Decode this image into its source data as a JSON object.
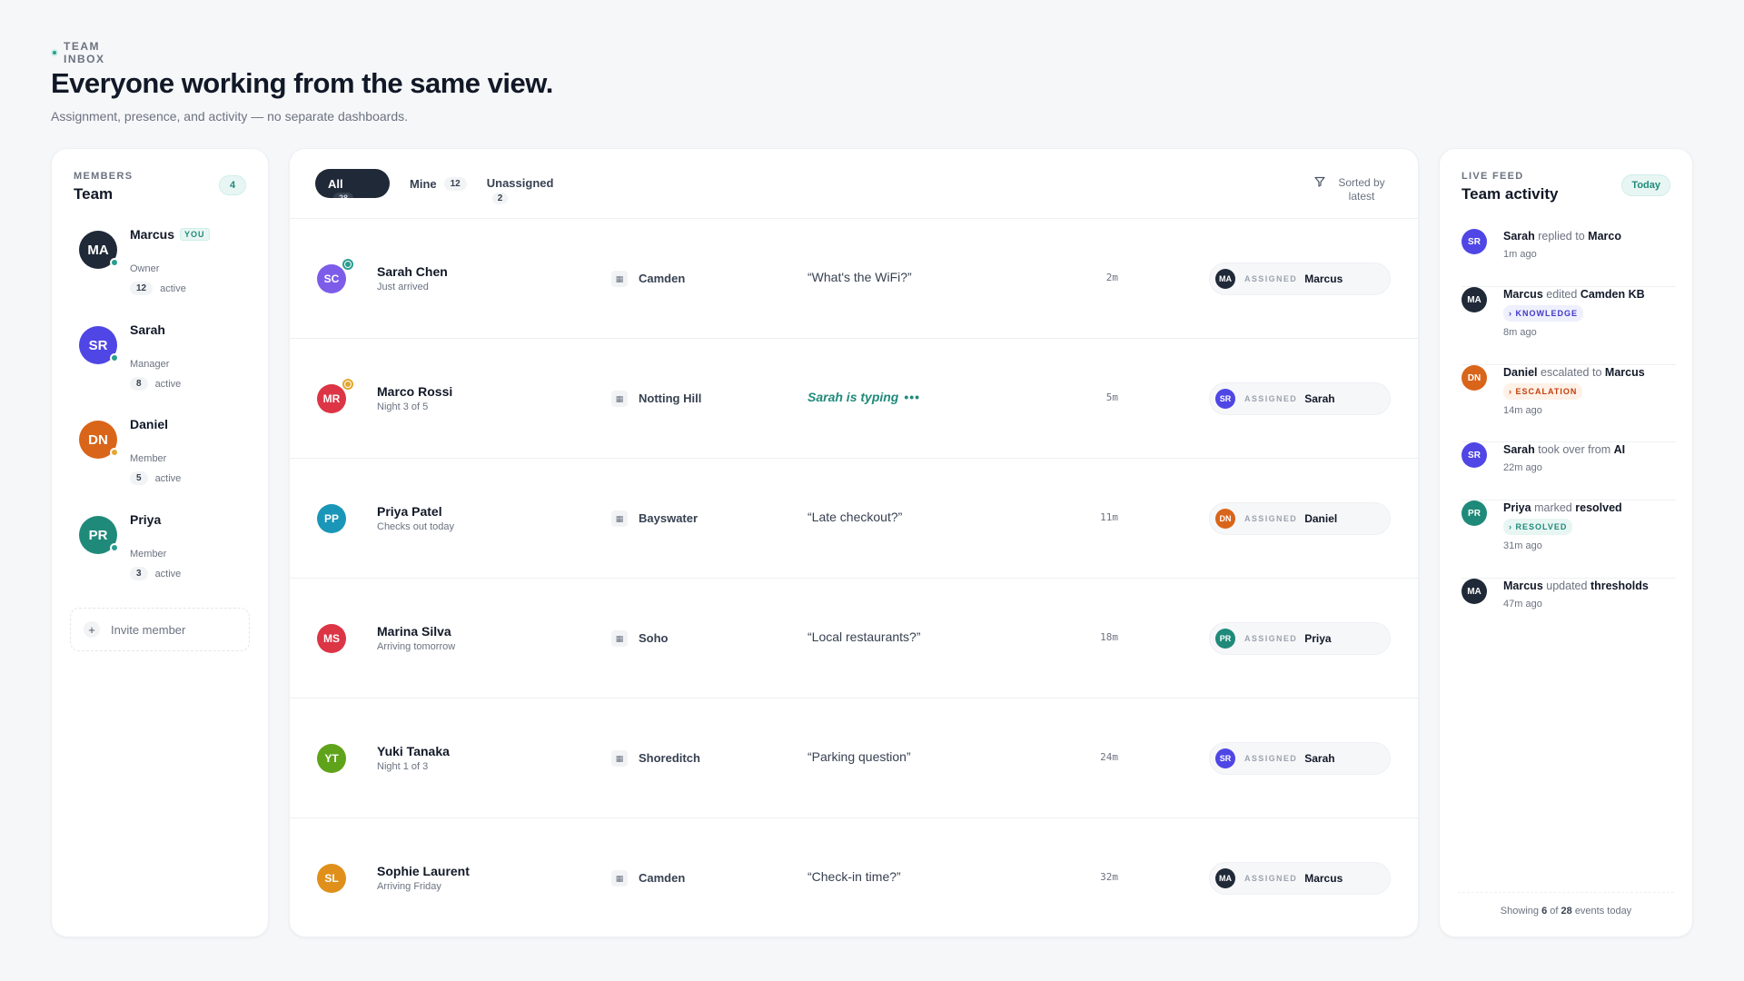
{
  "header": {
    "eyebrow": "TEAM INBOX",
    "title": "Everyone working from the same view.",
    "subtitle": "Assignment, presence, and activity — no separate dashboards."
  },
  "members": {
    "eyebrow": "MEMBERS",
    "title": "Team",
    "count": "4",
    "items": [
      {
        "initials": "MA",
        "name": "Marcus",
        "you": "YOU",
        "role": "Owner",
        "active_count": "12",
        "active_label": "active",
        "color": "#1f2937",
        "presence": "#2a9d8f"
      },
      {
        "initials": "SR",
        "name": "Sarah",
        "you": "",
        "role": "Manager",
        "active_count": "8",
        "active_label": "active",
        "color": "#4f46e5",
        "presence": "#2a9d8f"
      },
      {
        "initials": "DN",
        "name": "Daniel",
        "you": "",
        "role": "Member",
        "active_count": "5",
        "active_label": "active",
        "color": "#d9651a",
        "presence": "#e3a72f"
      },
      {
        "initials": "PR",
        "name": "Priya",
        "you": "",
        "role": "Member",
        "active_count": "3",
        "active_label": "active",
        "color": "#1f8a7a",
        "presence": "#2a9d8f"
      }
    ],
    "invite_label": "Invite member"
  },
  "tabs": [
    {
      "label": "All",
      "count": "28"
    },
    {
      "label": "Mine",
      "count": "12"
    },
    {
      "label": "Unassigned",
      "count": "2"
    }
  ],
  "sort_label": "Sorted by latest",
  "assigned_label": "ASSIGNED",
  "conversations": [
    {
      "initials": "SC",
      "color": "#7c5ce8",
      "name": "Sarah Chen",
      "sub": "Just arrived",
      "status_color": "#2a9d8f",
      "property": "Camden",
      "message": "“What's the WiFi?”",
      "typing": false,
      "time": "2m",
      "assignee_initials": "MA",
      "assignee_color": "#1f2937",
      "assignee": "Marcus"
    },
    {
      "initials": "MR",
      "color": "#dc3545",
      "name": "Marco Rossi",
      "sub": "Night 3 of 5",
      "status_color": "#e3a72f",
      "property": "Notting Hill",
      "message": "Sarah is typing",
      "typing": true,
      "time": "5m",
      "assignee_initials": "SR",
      "assignee_color": "#4f46e5",
      "assignee": "Sarah"
    },
    {
      "initials": "PP",
      "color": "#1a96b8",
      "name": "Priya Patel",
      "sub": "Checks out today",
      "status_color": "",
      "property": "Bayswater",
      "message": "“Late checkout?”",
      "typing": false,
      "time": "11m",
      "assignee_initials": "DN",
      "assignee_color": "#d9651a",
      "assignee": "Daniel"
    },
    {
      "initials": "MS",
      "color": "#dc3545",
      "name": "Marina Silva",
      "sub": "Arriving tomorrow",
      "status_color": "",
      "property": "Soho",
      "message": "“Local restaurants?”",
      "typing": false,
      "time": "18m",
      "assignee_initials": "PR",
      "assignee_color": "#1f8a7a",
      "assignee": "Priya"
    },
    {
      "initials": "YT",
      "color": "#5fa31a",
      "name": "Yuki Tanaka",
      "sub": "Night 1 of 3",
      "status_color": "",
      "property": "Shoreditch",
      "message": "“Parking question”",
      "typing": false,
      "time": "24m",
      "assignee_initials": "SR",
      "assignee_color": "#4f46e5",
      "assignee": "Sarah"
    },
    {
      "initials": "SL",
      "color": "#e0901a",
      "name": "Sophie Laurent",
      "sub": "Arriving Friday",
      "status_color": "",
      "property": "Camden",
      "message": "“Check-in time?”",
      "typing": false,
      "time": "32m",
      "assignee_initials": "MA",
      "assignee_color": "#1f2937",
      "assignee": "Marcus"
    }
  ],
  "feed": {
    "eyebrow": "LIVE FEED",
    "title": "Team activity",
    "badge": "Today",
    "events": [
      {
        "initials": "SR",
        "color": "#4f46e5",
        "actor": "Sarah",
        "verb": "replied to",
        "target": "Marco",
        "tag": "",
        "tag_type": "",
        "time": "1m ago"
      },
      {
        "initials": "MA",
        "color": "#1f2937",
        "actor": "Marcus",
        "verb": "edited",
        "target": "Camden KB",
        "tag": "KNOWLEDGE",
        "tag_type": "knowledge",
        "time": "8m ago"
      },
      {
        "initials": "DN",
        "color": "#d9651a",
        "actor": "Daniel",
        "verb": "escalated to",
        "target": "Marcus",
        "tag": "ESCALATION",
        "tag_type": "escalation",
        "time": "14m ago"
      },
      {
        "initials": "SR",
        "color": "#4f46e5",
        "actor": "Sarah",
        "verb": "took over from",
        "target": "AI",
        "tag": "",
        "tag_type": "",
        "time": "22m ago"
      },
      {
        "initials": "PR",
        "color": "#1f8a7a",
        "actor": "Priya",
        "verb": "marked",
        "target": "resolved",
        "tag": "RESOLVED",
        "tag_type": "resolved",
        "time": "31m ago"
      },
      {
        "initials": "MA",
        "color": "#1f2937",
        "actor": "Marcus",
        "verb": "updated",
        "target": "thresholds",
        "tag": "",
        "tag_type": "",
        "time": "47m ago"
      }
    ],
    "footer_prefix": "Showing",
    "footer_shown": "6",
    "footer_of": "of",
    "footer_total": "28",
    "footer_suffix": "events today"
  }
}
